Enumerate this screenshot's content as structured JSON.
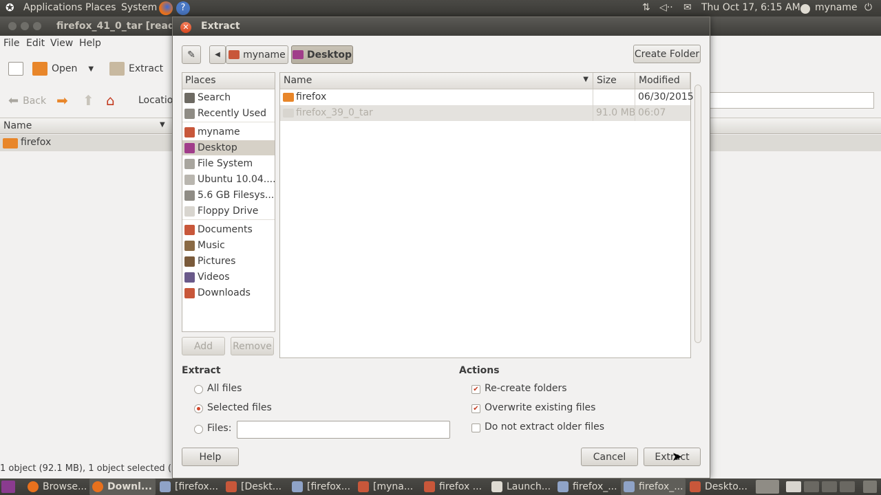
{
  "top_panel": {
    "applications": "Applications",
    "places": "Places",
    "system": "System",
    "datetime": "Thu Oct 17,  6:15 AM",
    "username": "myname"
  },
  "background_window": {
    "title": "firefox_41_0_tar [read",
    "menu": [
      "File",
      "Edit",
      "View",
      "Help"
    ],
    "toolbar": {
      "open": "Open",
      "extract": "Extract",
      "back": "Back",
      "location": "Locatio"
    },
    "column_name": "Name",
    "row": "firefox",
    "status": "1 object (92.1 MB), 1 object selected (("
  },
  "dialog": {
    "title": "Extract",
    "path": [
      "myname",
      "Desktop"
    ],
    "create_folder": "Create Folder",
    "places_header": "Places",
    "places": [
      {
        "label": "Search",
        "icon": "search-icon"
      },
      {
        "label": "Recently Used",
        "icon": "clock-icon"
      },
      {
        "label": "myname",
        "icon": "home-folder-icon"
      },
      {
        "label": "Desktop",
        "icon": "desktop-icon"
      },
      {
        "label": "File System",
        "icon": "drive-icon"
      },
      {
        "label": "Ubuntu 10.04....",
        "icon": "cdrom-icon"
      },
      {
        "label": "5.6 GB Filesys...",
        "icon": "disk-icon"
      },
      {
        "label": "Floppy Drive",
        "icon": "floppy-icon"
      },
      {
        "label": "Documents",
        "icon": "documents-folder-icon"
      },
      {
        "label": "Music",
        "icon": "music-folder-icon"
      },
      {
        "label": "Pictures",
        "icon": "pictures-folder-icon"
      },
      {
        "label": "Videos",
        "icon": "videos-folder-icon"
      },
      {
        "label": "Downloads",
        "icon": "downloads-folder-icon"
      }
    ],
    "add": "Add",
    "remove": "Remove",
    "columns": {
      "name": "Name",
      "size": "Size",
      "modified": "Modified"
    },
    "files": [
      {
        "name": "firefox",
        "size": "",
        "modified": "06/30/2015"
      },
      {
        "name": "firefox_39_0_tar",
        "size": "91.0 MB",
        "modified": "06:07"
      }
    ],
    "extract_section": {
      "heading": "Extract",
      "all_files": "All files",
      "selected_files": "Selected files",
      "files_label": "Files:",
      "files_value": "",
      "selected": "selected_files"
    },
    "actions_section": {
      "heading": "Actions",
      "recreate": "Re-create folders",
      "overwrite": "Overwrite existing files",
      "no_older": "Do not extract older files",
      "recreate_checked": true,
      "overwrite_checked": true,
      "no_older_checked": false
    },
    "help": "Help",
    "cancel": "Cancel",
    "extract_btn": "Extract"
  },
  "taskbar": [
    {
      "label": "Browse...",
      "icon": "firefox-icon"
    },
    {
      "label": "Downl...",
      "icon": "firefox-icon",
      "active": true
    },
    {
      "label": "[firefox...",
      "icon": "archive-icon"
    },
    {
      "label": "[Deskt...",
      "icon": "folder-icon"
    },
    {
      "label": "[firefox...",
      "icon": "archive-icon"
    },
    {
      "label": "[myna...",
      "icon": "folder-icon"
    },
    {
      "label": "firefox ...",
      "icon": "folder-icon"
    },
    {
      "label": "Launch...",
      "icon": "launcher-icon"
    },
    {
      "label": "firefox_...",
      "icon": "archive-icon"
    },
    {
      "label": "firefox_...",
      "icon": "archive-icon",
      "active": true
    },
    {
      "label": "Deskto...",
      "icon": "folder-icon"
    }
  ],
  "colors": {
    "panel": "#3b3a36",
    "accent": "#d2452a",
    "selection": "#d6d1c7"
  }
}
